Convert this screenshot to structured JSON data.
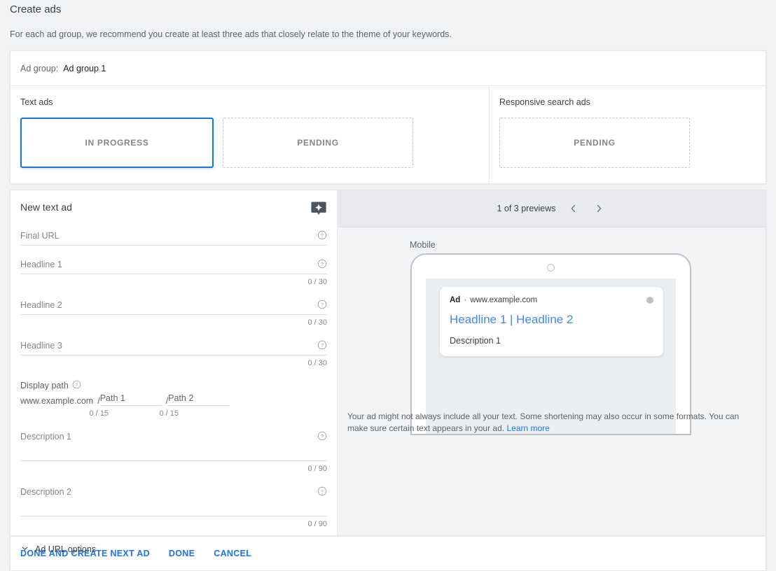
{
  "page": {
    "title": "Create ads",
    "subtitle": "For each ad group, we recommend you create at least three ads that closely relate to the theme of your keywords."
  },
  "ad_group": {
    "label": "Ad group:",
    "value": "Ad group 1"
  },
  "ad_types": {
    "text_ads": {
      "title": "Text ads",
      "boxes": [
        {
          "label": "IN PROGRESS",
          "state": "selected"
        },
        {
          "label": "PENDING",
          "state": "pending"
        }
      ]
    },
    "responsive_search_ads": {
      "title": "Responsive search ads",
      "boxes": [
        {
          "label": "PENDING",
          "state": "pending"
        }
      ]
    }
  },
  "form": {
    "title": "New text ad",
    "sparkle_icon": "sparkle-bubble-icon",
    "help_icon": "help-circle-icon",
    "fields": [
      {
        "label": "Final URL",
        "value": "",
        "counter": ""
      },
      {
        "label": "Headline 1",
        "value": "",
        "counter": "0 / 30"
      },
      {
        "label": "Headline 2",
        "value": "",
        "counter": "0 / 30"
      },
      {
        "label": "Headline 3",
        "value": "",
        "counter": "0 / 30"
      }
    ],
    "display_path": {
      "label": "Display path",
      "domain": "www.example.com",
      "slash": "/",
      "path1_placeholder": "Path 1",
      "path1_value": "",
      "path1_counter": "0 / 15",
      "path2_placeholder": "Path 2",
      "path2_value": "",
      "path2_counter": "0 / 15"
    },
    "descriptions": [
      {
        "label": "Description 1",
        "value": "",
        "counter": "0 / 90"
      },
      {
        "label": "Description 2",
        "value": "",
        "counter": "0 / 90"
      }
    ],
    "url_options": {
      "label": "Ad URL options",
      "chevron": "chevron-down-icon"
    }
  },
  "preview": {
    "count_label": "1 of 3 previews",
    "prev_icon": "chevron-left-icon",
    "next_icon": "chevron-right-icon",
    "device_label": "Mobile",
    "ad": {
      "badge": "Ad",
      "separator": "·",
      "url": "www.example.com",
      "headline": "Headline 1 | Headline 2",
      "description": "Description 1",
      "info_icon": "info-dot-icon"
    },
    "disclaimer": "Your ad might not always include all your text. Some shortening may also occur in some formats. You can make sure certain text appears in your ad.",
    "learn_more": "Learn more"
  },
  "footer": {
    "actions": [
      "DONE AND CREATE NEXT AD",
      "DONE",
      "CANCEL"
    ]
  },
  "colors": {
    "accent": "#1a73e8",
    "link": "#4285f4",
    "page_bg": "#f1f3f4"
  }
}
